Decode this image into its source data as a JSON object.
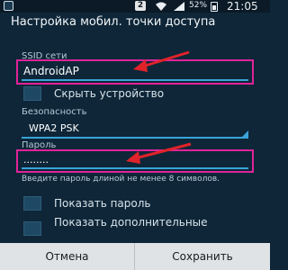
{
  "status_bar": {
    "badge": "2",
    "battery": "52%",
    "time": "21:05"
  },
  "dialog": {
    "title": "Настройка мобил. точки доступа",
    "ssid_label": "SSID сети",
    "ssid_value": "AndroidAP",
    "hide_device_label": "Скрыть устройство",
    "security_label": "Безопасность",
    "security_value": "WPA2 PSK",
    "password_label": "Пароль",
    "password_value": "........",
    "password_hint": "Введите пароль длиной не менее 8 символов.",
    "show_password_label": "Показать пароль",
    "show_advanced_label": "Показать дополнительные"
  },
  "buttons": {
    "cancel": "Отмена",
    "save": "Сохранить"
  },
  "colors": {
    "background": "#0e2638",
    "accent": "#3aa4d8",
    "highlight": "#e0239a",
    "arrow": "#e0232a"
  },
  "icons": [
    "notification-icon",
    "wifi-icon",
    "signal-icon",
    "battery-icon",
    "dropdown-arrow-icon"
  ]
}
